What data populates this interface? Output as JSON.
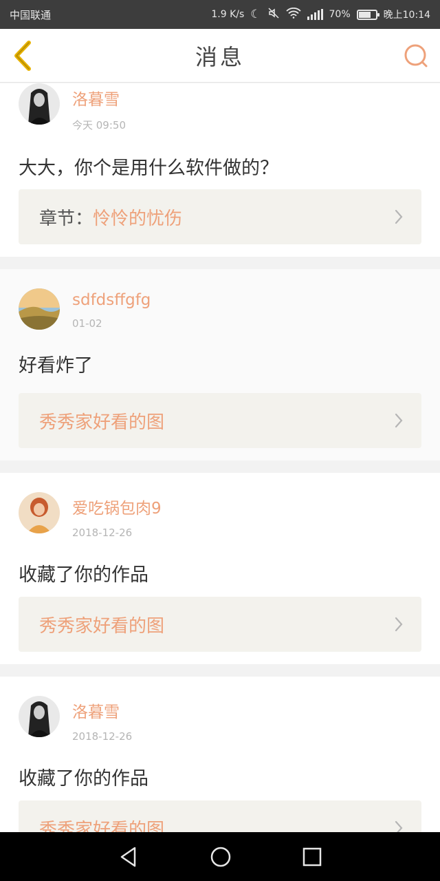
{
  "status_bar": {
    "carrier": "中国联通",
    "speed": "1.9 K/s",
    "battery_percent": "70%",
    "battery_level": 0.7,
    "time": "晚上10:14"
  },
  "header": {
    "title": "消息"
  },
  "messages": [
    {
      "name": "洛暮雪",
      "time": "今天 09:50",
      "comment": "大大，你个是用什么软件做的？",
      "ref_prefix": "章节：",
      "ref_title": "怜怜的忧伤"
    },
    {
      "name": "sdfdsffgfg",
      "time": "01-02",
      "comment": "好看炸了",
      "ref_prefix": "",
      "ref_title": "秀秀家好看的图"
    },
    {
      "name": "爱吃锅包肉9",
      "time": "2018-12-26",
      "comment": "收藏了你的作品",
      "ref_prefix": "",
      "ref_title": "秀秀家好看的图"
    },
    {
      "name": "洛暮雪",
      "time": "2018-12-26",
      "comment": "收藏了你的作品",
      "ref_prefix": "",
      "ref_title": "秀秀家好看的图"
    }
  ],
  "icons": {
    "back": "chevron-left-icon",
    "search": "search-icon",
    "chevron": "chevron-right-icon",
    "nav_back": "triangle-back-icon",
    "nav_home": "circle-home-icon",
    "nav_recent": "square-recent-icon"
  },
  "colors": {
    "accent": "#eea17a",
    "back_arrow": "#e8b200",
    "status_bar": "#3d3d3d"
  }
}
